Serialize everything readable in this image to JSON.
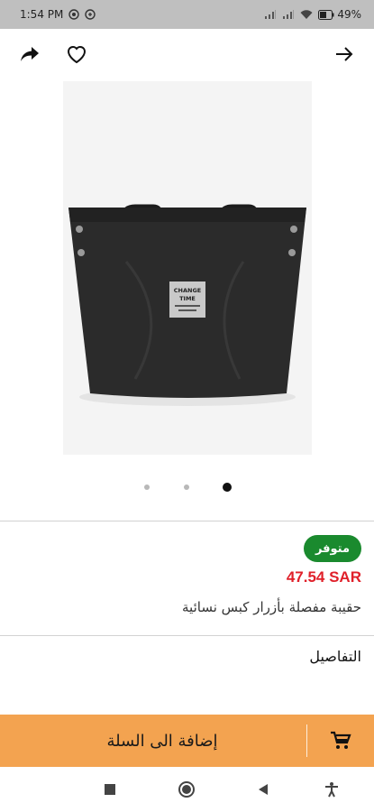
{
  "status_bar": {
    "time": "1:54 PM",
    "battery": "49%"
  },
  "top_bar": {
    "icons": [
      "share-icon",
      "heart-icon",
      "arrow-forward-icon"
    ]
  },
  "carousel": {
    "dot_count": 3,
    "active_index": 2
  },
  "product": {
    "availability": "متوفر",
    "price": "47.54 SAR",
    "name": "حقيبة مفصلة بأزرار كبس نسائية",
    "details_label": "التفاصيل",
    "image_tag_text": [
      "CHANGE",
      "TIME"
    ]
  },
  "cart": {
    "button_label": "إضافة الى السلة",
    "icon": "cart-icon"
  },
  "colors": {
    "accent": "#f3a350",
    "available_badge": "#1a8a2e",
    "price": "#e0202a"
  }
}
